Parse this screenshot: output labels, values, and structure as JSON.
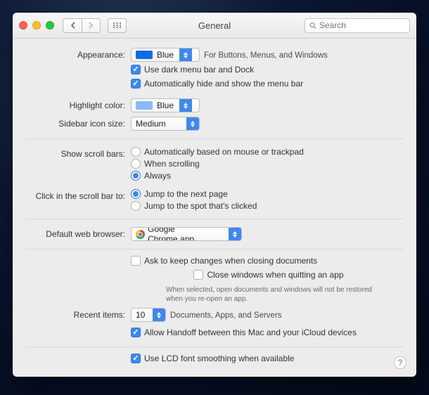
{
  "window": {
    "title": "General"
  },
  "search": {
    "placeholder": "Search"
  },
  "labels": {
    "appearance": "Appearance:",
    "highlight": "Highlight color:",
    "sidebar": "Sidebar icon size:",
    "scrollbars": "Show scroll bars:",
    "clickscroll": "Click in the scroll bar to:",
    "defaultbrowser": "Default web browser:",
    "recent": "Recent items:"
  },
  "appearance": {
    "value": "Blue",
    "desc": "For Buttons, Menus, and Windows",
    "dark_menu_check": "Use dark menu bar and Dock",
    "autohide_check": "Automatically hide and show the menu bar"
  },
  "highlight": {
    "value": "Blue"
  },
  "sidebar": {
    "value": "Medium"
  },
  "scroll": {
    "opt1": "Automatically based on mouse or trackpad",
    "opt2": "When scrolling",
    "opt3": "Always"
  },
  "click": {
    "opt1": "Jump to the next page",
    "opt2": "Jump to the spot that's clicked"
  },
  "browser": {
    "value": "Google Chrome.app"
  },
  "docs": {
    "ask": "Ask to keep changes when closing documents",
    "close": "Close windows when quitting an app",
    "help": "When selected, open documents and windows will not be restored when you re-open an app."
  },
  "recent": {
    "value": "10",
    "desc": "Documents, Apps, and Servers"
  },
  "handoff": "Allow Handoff between this Mac and your iCloud devices",
  "lcd": "Use LCD font smoothing when available"
}
